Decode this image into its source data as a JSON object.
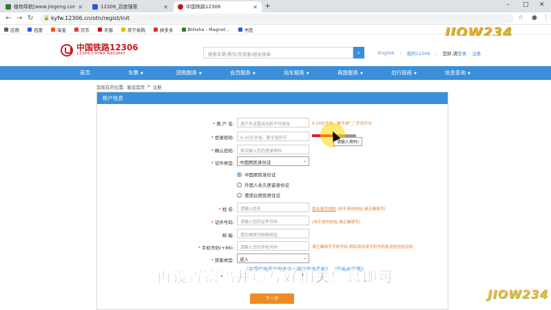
{
  "browser": {
    "tabs": [
      {
        "label": "植物导航[www.jiegeng.com]_初",
        "active": false,
        "color": "#2e7d32"
      },
      {
        "label": "12306_百度搜索",
        "active": false,
        "color": "#2b57d6"
      },
      {
        "label": "中国铁路12306",
        "active": true,
        "color": "#c8161d"
      }
    ],
    "new_tab": "+",
    "window_controls": [
      "–",
      "□",
      "✕"
    ],
    "url": "kyfw.12306.cn/otn/regist/init",
    "bookmarks": [
      {
        "label": "应用",
        "color": "#5f6368"
      },
      {
        "label": "百度",
        "color": "#2b57d6"
      },
      {
        "label": "淘宝",
        "color": "#ff5000"
      },
      {
        "label": "京东",
        "color": "#e4393c"
      },
      {
        "label": "天猫",
        "color": "#d6001c"
      },
      {
        "label": "苏宁易购",
        "color": "#f7b500"
      },
      {
        "label": "拼多多",
        "color": "#e02e24"
      },
      {
        "label": "BtHaha - Magnet...",
        "color": "#2e7d32"
      },
      {
        "label": "书签",
        "color": "#2b57d6"
      }
    ]
  },
  "watermark": {
    "text": "JIOW234"
  },
  "site": {
    "brand_cn": "中国铁路12306",
    "brand_en": "12306 CHINA RAILWAY",
    "search_placeholder": "搜索车票/餐饮/常旅客/相关规章",
    "header_links": {
      "lang": "English",
      "my": "我的12306",
      "hello": "您好,请",
      "login": "登录",
      "register": "注册"
    },
    "nav": [
      {
        "label": "首页",
        "caret": false
      },
      {
        "label": "车票",
        "caret": true
      },
      {
        "label": "团购服务",
        "caret": true
      },
      {
        "label": "会员服务",
        "caret": true
      },
      {
        "label": "站车服务",
        "caret": true
      },
      {
        "label": "商旅服务",
        "caret": true
      },
      {
        "label": "出行指南",
        "caret": true
      },
      {
        "label": "信息查询",
        "caret": true
      }
    ],
    "breadcrumb": {
      "prefix": "您现在的位置:",
      "home": "客运首页",
      "sep": ">",
      "current": "注册"
    }
  },
  "form": {
    "panel_title": "账户信息",
    "username": {
      "label": "用 户 名:",
      "placeholder": "用户名设置成功后不可修改",
      "hint": "6-30位字母、数字或\"_\",字母开头"
    },
    "password": {
      "label": "登录密码:",
      "placeholder": "6-20位字母、数字或符号",
      "strength": 0.5,
      "tooltip": "请输入密码!"
    },
    "confirm": {
      "label": "确认密码:",
      "placeholder": "再次输入您的登录密码"
    },
    "id_type": {
      "label": "证件类型:",
      "value": "中国居民身份证"
    },
    "residency": [
      {
        "label": "中国居民身份证",
        "checked": true
      },
      {
        "label": "外国人永久居留身份证",
        "checked": false
      },
      {
        "label": "港澳台居民居住证",
        "checked": false
      }
    ],
    "name": {
      "label": "姓   名:",
      "placeholder": "请输入姓名",
      "hint_link": "姓名填写规则",
      "hint": "(用于身份核验,请正确填写)"
    },
    "id_number": {
      "label": "证件号码:",
      "placeholder": "请输入您的证件号码",
      "hint": "(用于身份核验,请正确填写)"
    },
    "email": {
      "label": "邮   箱:",
      "placeholder": "请正确填写邮箱地址"
    },
    "phone": {
      "label": "手机号码(+86):",
      "placeholder": "请输入您的手机号码",
      "hint": "请正确填写手机号码,稍后将向该手机号码发送短信验证码"
    },
    "passenger_type": {
      "label": "旅客类型:",
      "value": "成人"
    },
    "agree": "《中国铁路客户服务中心网站服务条款》 《隐私权政策》",
    "next_button": "下一步"
  },
  "subtitle": "再设置密码并填写好相关信息即可"
}
